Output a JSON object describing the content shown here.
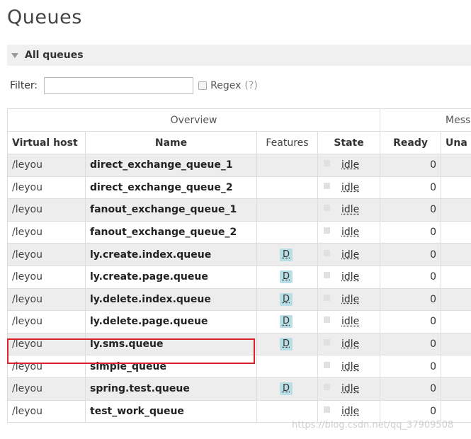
{
  "page": {
    "title": "Queues"
  },
  "section": {
    "title": "All queues"
  },
  "filter": {
    "label": "Filter:",
    "value": "",
    "regex_label": "Regex",
    "regex_help": "(?)"
  },
  "table": {
    "group_headers": [
      "Overview",
      "Mess"
    ],
    "columns": [
      "Virtual host",
      "Name",
      "Features",
      "State",
      "Ready",
      "Una"
    ],
    "rows": [
      {
        "vhost": "/leyou",
        "name": "direct_exchange_queue_1",
        "features": "",
        "state": "idle",
        "ready": "0"
      },
      {
        "vhost": "/leyou",
        "name": "direct_exchange_queue_2",
        "features": "",
        "state": "idle",
        "ready": "0"
      },
      {
        "vhost": "/leyou",
        "name": "fanout_exchange_queue_1",
        "features": "",
        "state": "idle",
        "ready": "0"
      },
      {
        "vhost": "/leyou",
        "name": "fanout_exchange_queue_2",
        "features": "",
        "state": "idle",
        "ready": "0"
      },
      {
        "vhost": "/leyou",
        "name": "ly.create.index.queue",
        "features": "D",
        "state": "idle",
        "ready": "0"
      },
      {
        "vhost": "/leyou",
        "name": "ly.create.page.queue",
        "features": "D",
        "state": "idle",
        "ready": "0"
      },
      {
        "vhost": "/leyou",
        "name": "ly.delete.index.queue",
        "features": "D",
        "state": "idle",
        "ready": "0"
      },
      {
        "vhost": "/leyou",
        "name": "ly.delete.page.queue",
        "features": "D",
        "state": "idle",
        "ready": "0"
      },
      {
        "vhost": "/leyou",
        "name": "ly.sms.queue",
        "features": "D",
        "state": "idle",
        "ready": "0"
      },
      {
        "vhost": "/leyou",
        "name": "simple_queue",
        "features": "",
        "state": "idle",
        "ready": "0"
      },
      {
        "vhost": "/leyou",
        "name": "spring.test.queue",
        "features": "D",
        "state": "idle",
        "ready": "0"
      },
      {
        "vhost": "/leyou",
        "name": "test_work_queue",
        "features": "",
        "state": "idle",
        "ready": "0"
      }
    ]
  },
  "watermark": "https://blog.csdn.net/qq_37909508",
  "colors": {
    "highlight": "#d9232d",
    "badge": "#b8dfe6",
    "stripe": "#ededed"
  }
}
